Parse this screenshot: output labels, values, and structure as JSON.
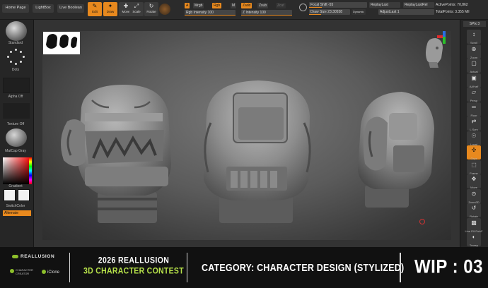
{
  "toolbar": {
    "home_page": "Home Page",
    "lightbox": "LightBox",
    "live_boolean": "Live Boolean",
    "tools": [
      {
        "glyph": "✎",
        "label": "Edit",
        "on": true
      },
      {
        "glyph": "✦",
        "label": "Draw",
        "on": true
      },
      {
        "glyph": "✚",
        "label": "Move",
        "on": false
      },
      {
        "glyph": "⤢",
        "label": "Scale",
        "on": false
      },
      {
        "glyph": "↻",
        "label": "Rotate",
        "on": false
      }
    ],
    "a_chip": "A",
    "mrgb": "Mrgb",
    "rgb": "Rgb",
    "m": "M",
    "rgb_intensity": "Rgb Intensity 100",
    "zadd": "Zadd",
    "zsub": "Zsub",
    "zcut": "Zcut",
    "z_intensity": "Z Intensity 100",
    "focal_shift": "Focal Shift -55",
    "draw_size": "Draw Size 23.30558",
    "dynamic": "Dynamic",
    "replay_last": "ReplayLast",
    "replay_last_rel": "ReplayLastRel",
    "adjust_last": "AdjustLast 1",
    "active_points": "ActivePoints: 70,862",
    "total_points": "TotalPoints: 3.355 Mil"
  },
  "left_tray": {
    "brush": "Standard",
    "stroke": "Dots",
    "alpha": "Alpha Off",
    "texture": "Texture Off",
    "material": "MatCap Gray",
    "gradient": "Gradient",
    "switch_color": "SwitchColor",
    "alternate": "Alternate"
  },
  "right_tray": {
    "spix": "SPix 3",
    "buttons": [
      {
        "icon": "scroll-icon",
        "glyph": "↕",
        "label": "Scroll"
      },
      {
        "icon": "zoom-icon",
        "glyph": "⊕",
        "label": "Zoom"
      },
      {
        "icon": "actual-icon",
        "glyph": "▢",
        "label": "Actual"
      },
      {
        "icon": "aahalf-icon",
        "glyph": "▣",
        "label": "AAHalf"
      },
      {
        "icon": "persp-icon",
        "glyph": "▱",
        "label": "Persp"
      },
      {
        "icon": "floor-icon",
        "glyph": "═",
        "label": "Floor"
      },
      {
        "icon": "lsym-icon",
        "glyph": "⇄",
        "label": "L.Sym"
      },
      {
        "icon": "local-icon",
        "glyph": "☉",
        "label": "Local"
      },
      {
        "icon": "xyz-icon",
        "glyph": "✣",
        "label": "Gxyz",
        "on": true
      },
      {
        "icon": "frame-icon",
        "glyph": "⬚",
        "label": "Frame"
      },
      {
        "icon": "move-icon",
        "glyph": "✥",
        "label": "Move"
      },
      {
        "icon": "zoom3d-icon",
        "glyph": "⊙",
        "label": "Zoom3D"
      },
      {
        "icon": "rotate-icon",
        "glyph": "↺",
        "label": "Rotate"
      },
      {
        "icon": "linefill-icon",
        "glyph": "▩",
        "label": "Line Fill PolyF"
      },
      {
        "icon": "transp-icon",
        "glyph": "◐",
        "label": "Transp"
      }
    ]
  },
  "banner": {
    "brand": "REALLUSION",
    "character_creator": "CHARACTER CREATOR",
    "iclone": "iClone",
    "contest_year": "2026 REALLUSION",
    "contest_name": "3D CHARACTER CONTEST",
    "category": "CATEGORY: CHARACTER DESIGN (STYLIZED)",
    "wip": "WIP : 03"
  },
  "colors": {
    "accent": "#e8891e",
    "contest_green": "#b7e24a",
    "clay": "#8e8e8e"
  }
}
